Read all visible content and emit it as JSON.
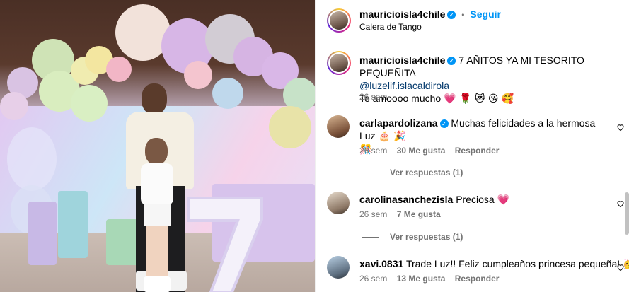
{
  "header": {
    "username": "mauricioisla4chile",
    "follow_label": "Seguir",
    "location": "Calera de Tango",
    "separator": "•"
  },
  "caption": {
    "username": "mauricioisla4chile",
    "text": "7 AÑITOS YA MI TESORITO PEQUEÑITA",
    "mention": "@luzelif.islacaldirola",
    "text2": "Te amoooo mucho",
    "emojis": "💗 🌹 😻 😘 🥰",
    "time": "26 sem"
  },
  "comments": [
    {
      "username": "carlapardolizana",
      "verified": true,
      "text": "Muchas felicidades a la hermosa Luz",
      "emojis_inline": "🎂 🎉",
      "emojis_line2": "🎊",
      "time": "26 sem",
      "likes": "30 Me gusta",
      "reply_label": "Responder",
      "view_replies": "Ver respuestas (1)"
    },
    {
      "username": "carolinasanchezisla",
      "verified": false,
      "text": "Preciosa",
      "emojis_inline": "💗",
      "time": "26 sem",
      "likes": "7 Me gusta",
      "view_replies": "Ver respuestas (1)"
    },
    {
      "username": "xavi.0831",
      "verified": false,
      "text": "Trade Luz!! Feliz cumpleaños princesa pequeña!",
      "emojis_inline": "🥳",
      "time": "26 sem",
      "likes": "13 Me gusta",
      "reply_label": "Responder"
    }
  ],
  "icons": {
    "verified": "verified-badge-icon",
    "like": "heart-outline-icon"
  },
  "colors": {
    "link": "#0095f6",
    "meta": "#737373",
    "heart_fill": "#ed4956"
  }
}
